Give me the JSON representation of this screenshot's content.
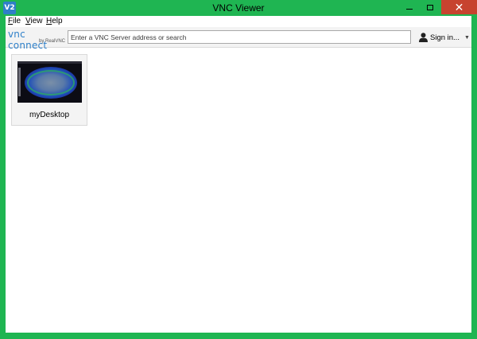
{
  "window": {
    "title": "VNC Viewer",
    "app_icon_text": "V2",
    "accent_color": "#1fb552",
    "close_color": "#c7432f"
  },
  "menu": {
    "file": "ile",
    "file_mnemonic": "F",
    "view": "iew",
    "view_mnemonic": "V",
    "help": "elp",
    "help_mnemonic": "H"
  },
  "toolbar": {
    "logo_main": "vnc connect",
    "logo_sub": "by RealVNC",
    "search_placeholder": "Enter a VNC Server address or search",
    "search_value": "",
    "signin_label": "Sign in...",
    "user_icon": "user-icon",
    "dropdown_icon": "chevron-down-icon"
  },
  "connections": [
    {
      "name": "myDesktop",
      "thumbnail": "desktop-thumbnail"
    }
  ]
}
